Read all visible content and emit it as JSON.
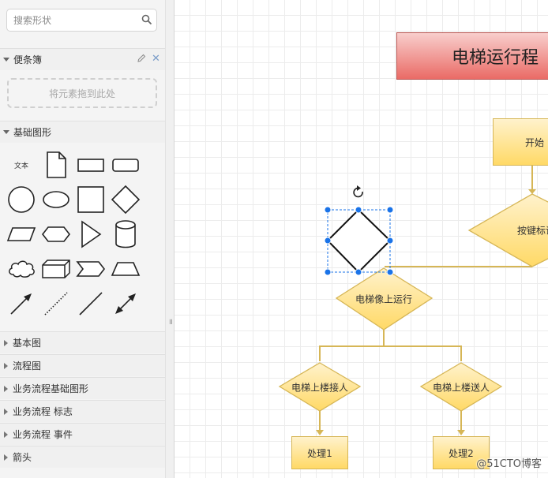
{
  "search": {
    "placeholder": "搜索形状"
  },
  "scratchpad": {
    "title": "便条簿",
    "drop_hint": "将元素拖到此处"
  },
  "basic_shapes": {
    "title": "基础图形",
    "text_shape_label": "文本"
  },
  "collapsed_sections": [
    "基本图",
    "流程图",
    "业务流程基础图形",
    "业务流程 标志",
    "业务流程 事件",
    "箭头"
  ],
  "diagram": {
    "title": "电梯运行程",
    "start": "开始",
    "key_decision": "按键标识",
    "up_decision": "电梯像上运行",
    "pickup": "电梯上楼接人",
    "dropoff": "电梯上楼送人",
    "process1": "处理1",
    "process2": "处理2"
  },
  "colors": {
    "title_fill": "#f8cecc",
    "title_stroke": "#b85450",
    "node_fill": "#fff2cc",
    "node_fill_dark": "#ffd966",
    "node_stroke": "#d6b656",
    "selection": "#1a73e8"
  },
  "watermark": "@51CTO博客"
}
